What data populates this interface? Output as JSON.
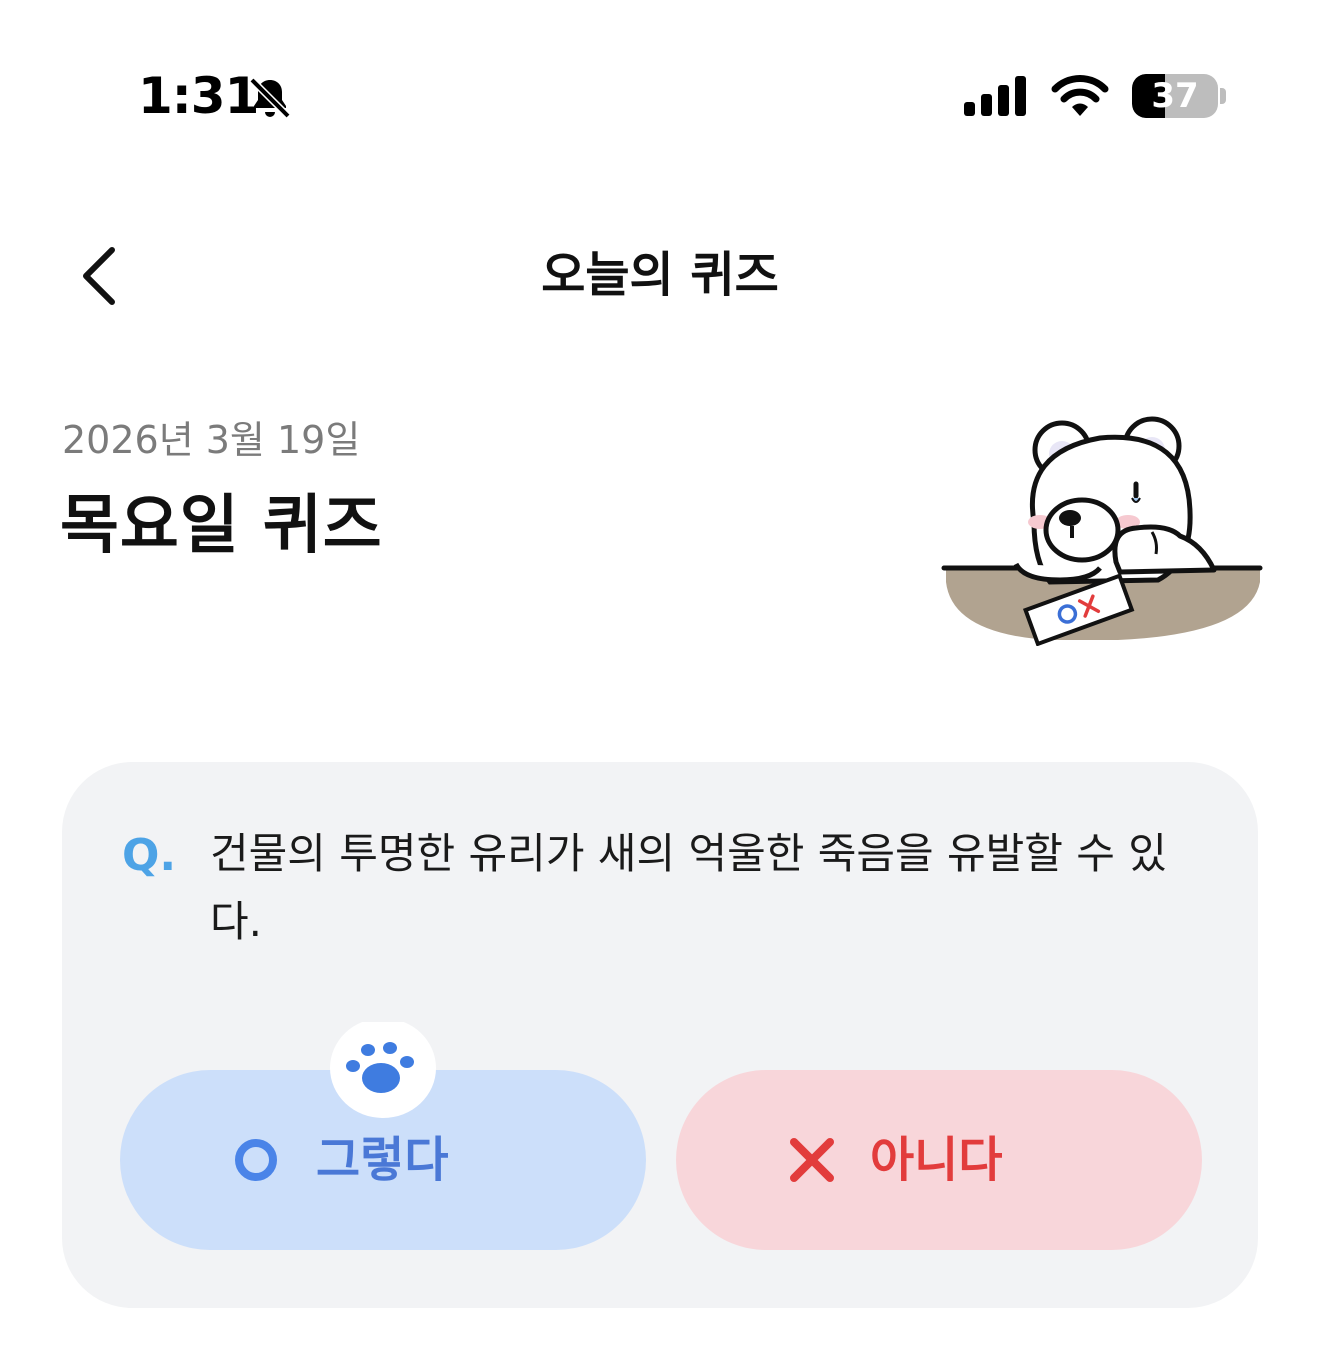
{
  "status_bar": {
    "time": "1:31",
    "battery_level": "37",
    "icons": [
      "bell-off-icon",
      "signal-icon",
      "wifi-icon",
      "battery-icon"
    ]
  },
  "header": {
    "title": "오늘의 퀴즈",
    "back_icon": "chevron-left-icon"
  },
  "quiz": {
    "date": "2026년 3월 19일",
    "title": "목요일 퀴즈",
    "question_marker": "Q.",
    "question": "건물의 투명한 유리가 새의 억울한 죽음을 유발할 수 있다.",
    "answers": {
      "yes_label": "그렇다",
      "no_label": "아니다"
    },
    "mascot_sheet_text": "OX"
  },
  "colors": {
    "accent_blue": "#4a78d6",
    "accent_red": "#e23c3c",
    "q_marker": "#4da3e6",
    "card_bg": "#f2f3f5",
    "yes_bg": "#ccdffa",
    "no_bg": "#f8d6da"
  }
}
